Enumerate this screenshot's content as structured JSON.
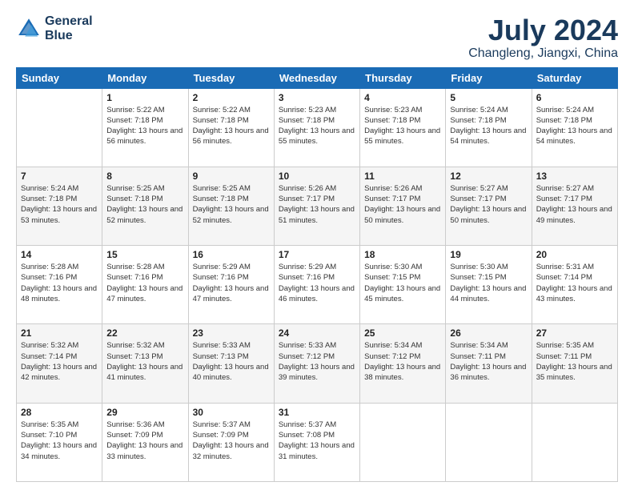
{
  "logo": {
    "line1": "General",
    "line2": "Blue"
  },
  "title": "July 2024",
  "subtitle": "Changleng, Jiangxi, China",
  "days": [
    "Sunday",
    "Monday",
    "Tuesday",
    "Wednesday",
    "Thursday",
    "Friday",
    "Saturday"
  ],
  "weeks": [
    [
      {
        "date": "",
        "sunrise": "",
        "sunset": "",
        "daylight": ""
      },
      {
        "date": "1",
        "sunrise": "Sunrise: 5:22 AM",
        "sunset": "Sunset: 7:18 PM",
        "daylight": "Daylight: 13 hours and 56 minutes."
      },
      {
        "date": "2",
        "sunrise": "Sunrise: 5:22 AM",
        "sunset": "Sunset: 7:18 PM",
        "daylight": "Daylight: 13 hours and 56 minutes."
      },
      {
        "date": "3",
        "sunrise": "Sunrise: 5:23 AM",
        "sunset": "Sunset: 7:18 PM",
        "daylight": "Daylight: 13 hours and 55 minutes."
      },
      {
        "date": "4",
        "sunrise": "Sunrise: 5:23 AM",
        "sunset": "Sunset: 7:18 PM",
        "daylight": "Daylight: 13 hours and 55 minutes."
      },
      {
        "date": "5",
        "sunrise": "Sunrise: 5:24 AM",
        "sunset": "Sunset: 7:18 PM",
        "daylight": "Daylight: 13 hours and 54 minutes."
      },
      {
        "date": "6",
        "sunrise": "Sunrise: 5:24 AM",
        "sunset": "Sunset: 7:18 PM",
        "daylight": "Daylight: 13 hours and 54 minutes."
      }
    ],
    [
      {
        "date": "7",
        "sunrise": "Sunrise: 5:24 AM",
        "sunset": "Sunset: 7:18 PM",
        "daylight": "Daylight: 13 hours and 53 minutes."
      },
      {
        "date": "8",
        "sunrise": "Sunrise: 5:25 AM",
        "sunset": "Sunset: 7:18 PM",
        "daylight": "Daylight: 13 hours and 52 minutes."
      },
      {
        "date": "9",
        "sunrise": "Sunrise: 5:25 AM",
        "sunset": "Sunset: 7:18 PM",
        "daylight": "Daylight: 13 hours and 52 minutes."
      },
      {
        "date": "10",
        "sunrise": "Sunrise: 5:26 AM",
        "sunset": "Sunset: 7:17 PM",
        "daylight": "Daylight: 13 hours and 51 minutes."
      },
      {
        "date": "11",
        "sunrise": "Sunrise: 5:26 AM",
        "sunset": "Sunset: 7:17 PM",
        "daylight": "Daylight: 13 hours and 50 minutes."
      },
      {
        "date": "12",
        "sunrise": "Sunrise: 5:27 AM",
        "sunset": "Sunset: 7:17 PM",
        "daylight": "Daylight: 13 hours and 50 minutes."
      },
      {
        "date": "13",
        "sunrise": "Sunrise: 5:27 AM",
        "sunset": "Sunset: 7:17 PM",
        "daylight": "Daylight: 13 hours and 49 minutes."
      }
    ],
    [
      {
        "date": "14",
        "sunrise": "Sunrise: 5:28 AM",
        "sunset": "Sunset: 7:16 PM",
        "daylight": "Daylight: 13 hours and 48 minutes."
      },
      {
        "date": "15",
        "sunrise": "Sunrise: 5:28 AM",
        "sunset": "Sunset: 7:16 PM",
        "daylight": "Daylight: 13 hours and 47 minutes."
      },
      {
        "date": "16",
        "sunrise": "Sunrise: 5:29 AM",
        "sunset": "Sunset: 7:16 PM",
        "daylight": "Daylight: 13 hours and 47 minutes."
      },
      {
        "date": "17",
        "sunrise": "Sunrise: 5:29 AM",
        "sunset": "Sunset: 7:16 PM",
        "daylight": "Daylight: 13 hours and 46 minutes."
      },
      {
        "date": "18",
        "sunrise": "Sunrise: 5:30 AM",
        "sunset": "Sunset: 7:15 PM",
        "daylight": "Daylight: 13 hours and 45 minutes."
      },
      {
        "date": "19",
        "sunrise": "Sunrise: 5:30 AM",
        "sunset": "Sunset: 7:15 PM",
        "daylight": "Daylight: 13 hours and 44 minutes."
      },
      {
        "date": "20",
        "sunrise": "Sunrise: 5:31 AM",
        "sunset": "Sunset: 7:14 PM",
        "daylight": "Daylight: 13 hours and 43 minutes."
      }
    ],
    [
      {
        "date": "21",
        "sunrise": "Sunrise: 5:32 AM",
        "sunset": "Sunset: 7:14 PM",
        "daylight": "Daylight: 13 hours and 42 minutes."
      },
      {
        "date": "22",
        "sunrise": "Sunrise: 5:32 AM",
        "sunset": "Sunset: 7:13 PM",
        "daylight": "Daylight: 13 hours and 41 minutes."
      },
      {
        "date": "23",
        "sunrise": "Sunrise: 5:33 AM",
        "sunset": "Sunset: 7:13 PM",
        "daylight": "Daylight: 13 hours and 40 minutes."
      },
      {
        "date": "24",
        "sunrise": "Sunrise: 5:33 AM",
        "sunset": "Sunset: 7:12 PM",
        "daylight": "Daylight: 13 hours and 39 minutes."
      },
      {
        "date": "25",
        "sunrise": "Sunrise: 5:34 AM",
        "sunset": "Sunset: 7:12 PM",
        "daylight": "Daylight: 13 hours and 38 minutes."
      },
      {
        "date": "26",
        "sunrise": "Sunrise: 5:34 AM",
        "sunset": "Sunset: 7:11 PM",
        "daylight": "Daylight: 13 hours and 36 minutes."
      },
      {
        "date": "27",
        "sunrise": "Sunrise: 5:35 AM",
        "sunset": "Sunset: 7:11 PM",
        "daylight": "Daylight: 13 hours and 35 minutes."
      }
    ],
    [
      {
        "date": "28",
        "sunrise": "Sunrise: 5:35 AM",
        "sunset": "Sunset: 7:10 PM",
        "daylight": "Daylight: 13 hours and 34 minutes."
      },
      {
        "date": "29",
        "sunrise": "Sunrise: 5:36 AM",
        "sunset": "Sunset: 7:09 PM",
        "daylight": "Daylight: 13 hours and 33 minutes."
      },
      {
        "date": "30",
        "sunrise": "Sunrise: 5:37 AM",
        "sunset": "Sunset: 7:09 PM",
        "daylight": "Daylight: 13 hours and 32 minutes."
      },
      {
        "date": "31",
        "sunrise": "Sunrise: 5:37 AM",
        "sunset": "Sunset: 7:08 PM",
        "daylight": "Daylight: 13 hours and 31 minutes."
      },
      {
        "date": "",
        "sunrise": "",
        "sunset": "",
        "daylight": ""
      },
      {
        "date": "",
        "sunrise": "",
        "sunset": "",
        "daylight": ""
      },
      {
        "date": "",
        "sunrise": "",
        "sunset": "",
        "daylight": ""
      }
    ]
  ]
}
